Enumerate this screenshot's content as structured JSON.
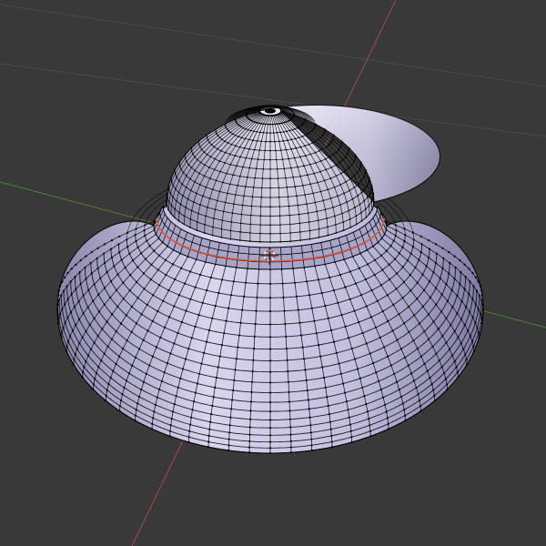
{
  "viewport": {
    "mode": "edit-mode-wireframe",
    "colors": {
      "background": "#393939",
      "grid_line": "#4a4a4a",
      "x_axis": "#c8524f",
      "y_axis": "#4f8a3a",
      "mesh_face": "#b9b6d6",
      "mesh_face_light": "#e6e3f5",
      "mesh_face_shadow": "#8e8ab0",
      "wire": "#000000",
      "selected_edge": "#e05a3a",
      "cursor_red": "#e0392b",
      "cursor_white": "#ffffff"
    },
    "icons": {
      "cursor": "3d-cursor-icon"
    }
  }
}
